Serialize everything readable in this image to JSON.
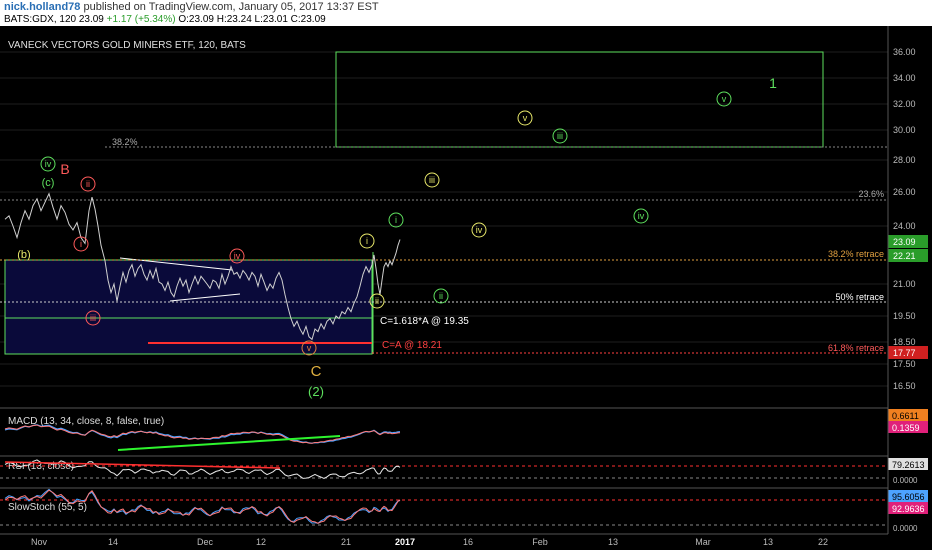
{
  "header": {
    "user": "nick.holland78",
    "published": " published on TradingView.com, January 05, 2017 13:37 EST",
    "symbol": "BATS:GDX, 120 ",
    "last": "23.09",
    "change": " +1.17 (+5.34%) ",
    "ohlc": "O:23.09  H:23.24  L:23.01  C:23.09"
  },
  "chart_data": {
    "type": "line",
    "title": "VANECK VECTORS GOLD MINERS ETF, 120, BATS",
    "price_ticks": [
      "36.00",
      "34.00",
      "32.00",
      "30.00",
      "28.00",
      "26.00",
      "24.00",
      "23.09",
      "22.21",
      "21.00",
      "19.50",
      "18.50",
      "17.77",
      "17.50",
      "16.50"
    ],
    "time_ticks": [
      "Nov",
      "14",
      "Dec",
      "12",
      "21",
      "2017",
      "16",
      "Feb",
      "13",
      "Mar",
      "13",
      "22"
    ],
    "price": [
      [
        0,
        24.4
      ],
      [
        4,
        24.6
      ],
      [
        8,
        24.0
      ],
      [
        12,
        23.4
      ],
      [
        16,
        24.2
      ],
      [
        20,
        24.9
      ],
      [
        24,
        24.4
      ],
      [
        28,
        25.2
      ],
      [
        32,
        25.6
      ],
      [
        36,
        24.9
      ],
      [
        40,
        25.4
      ],
      [
        44,
        25.9
      ],
      [
        48,
        25.1
      ],
      [
        52,
        24.4
      ],
      [
        56,
        25.2
      ],
      [
        60,
        24.8
      ],
      [
        64,
        24.1
      ],
      [
        68,
        23.8
      ],
      [
        72,
        24.2
      ],
      [
        76,
        23.4
      ],
      [
        80,
        23.1
      ],
      [
        84,
        24.9
      ],
      [
        87,
        25.7
      ],
      [
        90,
        25.0
      ],
      [
        93,
        24.0
      ],
      [
        96,
        23.0
      ],
      [
        100,
        22.2
      ],
      [
        103,
        21.2
      ],
      [
        106,
        20.6
      ],
      [
        109,
        21.0
      ],
      [
        112,
        20.2
      ],
      [
        115,
        20.9
      ],
      [
        118,
        21.6
      ],
      [
        121,
        21.1
      ],
      [
        124,
        21.7
      ],
      [
        127,
        22.0
      ],
      [
        130,
        21.4
      ],
      [
        133,
        21.8
      ],
      [
        136,
        22.0
      ],
      [
        139,
        21.5
      ],
      [
        142,
        21.2
      ],
      [
        145,
        21.7
      ],
      [
        148,
        21.3
      ],
      [
        151,
        21.8
      ],
      [
        154,
        21.1
      ],
      [
        157,
        21.0
      ],
      [
        160,
        20.7
      ],
      [
        163,
        21.1
      ],
      [
        166,
        20.6
      ],
      [
        169,
        20.4
      ],
      [
        172,
        20.9
      ],
      [
        175,
        21.3
      ],
      [
        178,
        20.9
      ],
      [
        181,
        21.2
      ],
      [
        184,
        20.6
      ],
      [
        187,
        21.0
      ],
      [
        190,
        21.4
      ],
      [
        193,
        21.0
      ],
      [
        196,
        21.4
      ],
      [
        199,
        21.2
      ],
      [
        202,
        21.0
      ],
      [
        205,
        20.8
      ],
      [
        208,
        21.2
      ],
      [
        211,
        21.1
      ],
      [
        214,
        20.8
      ],
      [
        217,
        21.5
      ],
      [
        220,
        21.0
      ],
      [
        223,
        21.4
      ],
      [
        226,
        21.9
      ],
      [
        229,
        21.5
      ],
      [
        232,
        21.6
      ],
      [
        235,
        21.3
      ],
      [
        238,
        21.7
      ],
      [
        241,
        21.5
      ],
      [
        244,
        21.2
      ],
      [
        247,
        21.6
      ],
      [
        250,
        21.4
      ],
      [
        253,
        20.9
      ],
      [
        256,
        21.5
      ],
      [
        259,
        21.1
      ],
      [
        262,
        20.7
      ],
      [
        265,
        21.0
      ],
      [
        268,
        20.8
      ],
      [
        271,
        21.3
      ],
      [
        274,
        21.6
      ],
      [
        277,
        21.2
      ],
      [
        280,
        20.5
      ],
      [
        283,
        19.9
      ],
      [
        286,
        19.4
      ],
      [
        289,
        19.1
      ],
      [
        292,
        19.3
      ],
      [
        295,
        19.0
      ],
      [
        298,
        18.8
      ],
      [
        301,
        19.1
      ],
      [
        304,
        18.7
      ],
      [
        307,
        18.6
      ],
      [
        310,
        19.0
      ],
      [
        313,
        18.9
      ],
      [
        316,
        19.2
      ],
      [
        319,
        19.0
      ],
      [
        322,
        19.3
      ],
      [
        325,
        19.4
      ],
      [
        328,
        19.2
      ],
      [
        331,
        19.5
      ],
      [
        334,
        19.4
      ],
      [
        337,
        19.7
      ],
      [
        340,
        19.6
      ],
      [
        343,
        19.9
      ],
      [
        346,
        19.7
      ],
      [
        349,
        20.1
      ],
      [
        352,
        20.4
      ],
      [
        355,
        20.9
      ],
      [
        358,
        21.5
      ],
      [
        361,
        21.9
      ],
      [
        364,
        21.6
      ],
      [
        367,
        22.0
      ],
      [
        369,
        22.5
      ],
      [
        371,
        21.8
      ],
      [
        373,
        21.0
      ],
      [
        375,
        20.5
      ],
      [
        377,
        21.2
      ],
      [
        379,
        21.9
      ],
      [
        381,
        22.1
      ],
      [
        383,
        21.9
      ],
      [
        385,
        22.2
      ],
      [
        387,
        22.0
      ],
      [
        389,
        22.3
      ],
      [
        391,
        22.6
      ],
      [
        393,
        23.0
      ],
      [
        395,
        23.3
      ]
    ],
    "fib_levels": [
      {
        "label": "38.2%",
        "price": 29.0
      },
      {
        "label": "23.6%",
        "price": 25.3
      },
      {
        "label": "38.2% retrace",
        "price": 22.2
      },
      {
        "label": "50% retrace",
        "price": 20.5
      },
      {
        "label": "61.8% retrace",
        "price": 17.77
      }
    ],
    "price_labels": [
      {
        "text": "C=1.618*A @ 19.35"
      },
      {
        "text": "C=A @ 18.21"
      }
    ],
    "wave_labels": {
      "red": [
        "B",
        "ii",
        "i",
        "iii",
        "iv",
        "v",
        "C=A @ 18.21"
      ],
      "green_big": [
        "(c)",
        "(b)",
        "iv",
        "(2)",
        "ii",
        "i",
        "iii",
        "iv",
        "v",
        "1"
      ],
      "yellow": [
        "C",
        "i",
        "ii",
        "iii",
        "iv",
        "v"
      ]
    },
    "macd": {
      "name": "MACD (13, 34, close, 8, false, true)",
      "value1": "0.6611",
      "value2": "0.1359"
    },
    "rsi": {
      "name": "RSI (13, close)",
      "value": "79.2613"
    },
    "stoch": {
      "name": "SlowStoch (55, 5)",
      "value1": "95.6056",
      "value2": "92.9636"
    },
    "osc_ticks": [
      "0.0000",
      "0.0000"
    ],
    "colors": {
      "bg": "#000000",
      "grid": "#555555",
      "price": "#d0d0d0",
      "green": "#5ee05e",
      "yellow": "#e8e86a",
      "red": "#ff5a5a"
    }
  }
}
